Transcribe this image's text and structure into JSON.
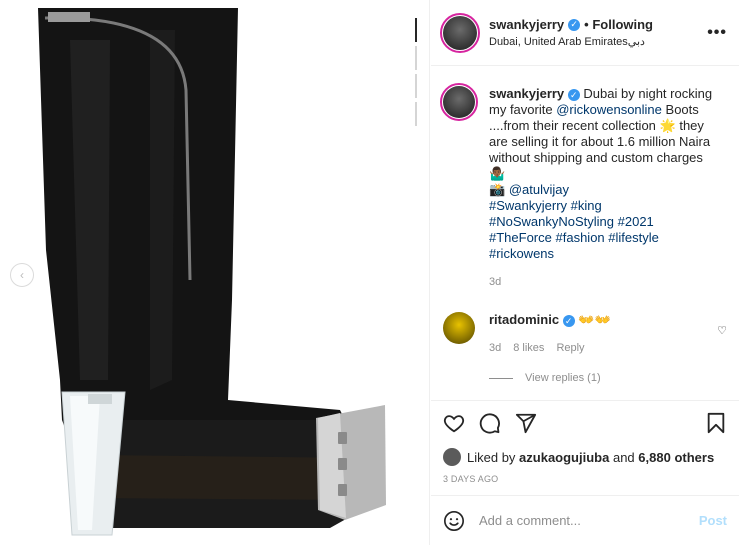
{
  "post": {
    "author": "swankyjerry",
    "follow_state": "• Following",
    "location": "Dubai, United Arab Emiratesدبي",
    "more_label": "•••",
    "caption_user": "swankyjerry",
    "caption_text_1": "Dubai by night rocking my favorite",
    "caption_mention": "@rickowensonline",
    "caption_text_2": "Boots ....from their recent collection",
    "caption_text_3": "they are selling it for about 1.6 million Naira without shipping and custom charges",
    "caption_camera_mention": "@atulvijay",
    "hashtags": [
      "#Swankyjerry",
      "#king",
      "#NoSwankyNoStyling",
      "#2021",
      "#TheForce",
      "#fashion",
      "#lifestyle",
      "#rickowens"
    ],
    "caption_age": "3d"
  },
  "comment": {
    "user": "ritadominic",
    "emojis": "👐👐",
    "age": "3d",
    "likes": "8 likes",
    "reply": "Reply",
    "view_replies": "View replies (1)"
  },
  "engagement": {
    "liked_by_prefix": "Liked by",
    "liked_by_user": "azukaogujiuba",
    "liked_by_and": "and",
    "others": "6,880 others",
    "posted": "3 DAYS AGO"
  },
  "composer": {
    "placeholder": "Add a comment...",
    "post_label": "Post"
  },
  "colors": {
    "accent": "#3897f0",
    "link": "#00376b",
    "post_disabled": "#b2dffc"
  }
}
